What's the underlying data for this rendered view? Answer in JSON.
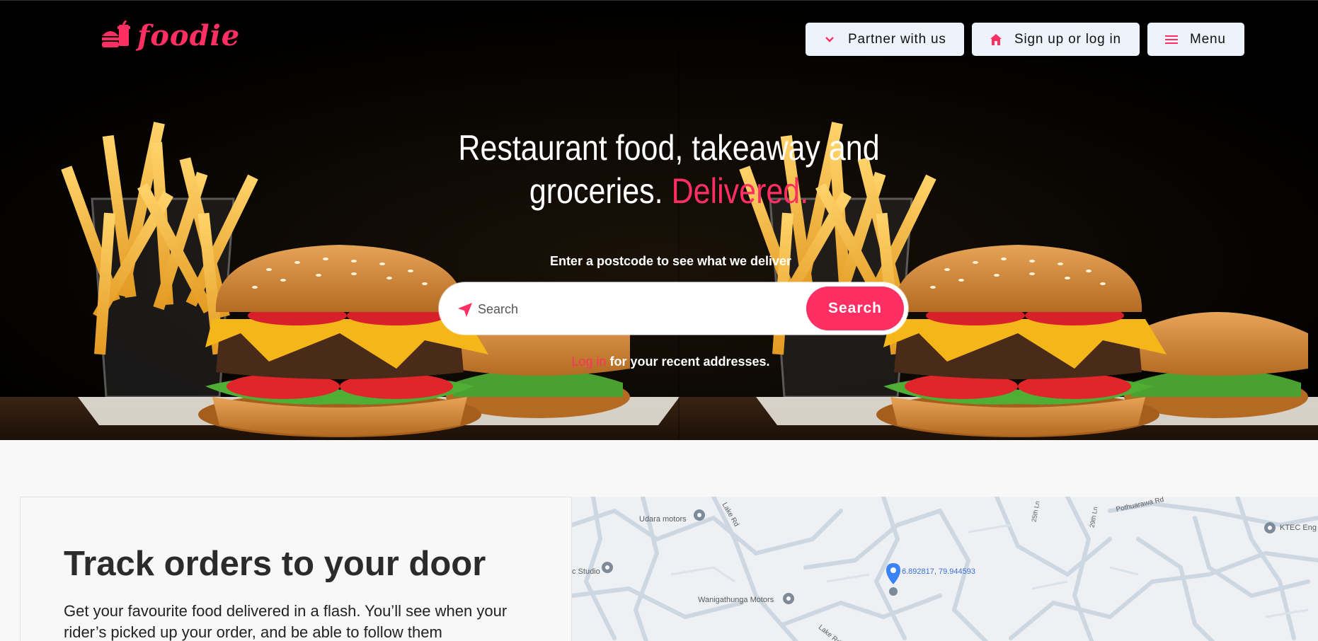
{
  "brand": {
    "name": "foodie",
    "accent_color": "#ff2e63"
  },
  "nav": {
    "partner_label": "Partner with us",
    "signup_label": "Sign up or log in",
    "menu_label": "Menu"
  },
  "hero": {
    "headline_part1": "Restaurant food, takeaway and",
    "headline_part2": "groceries.",
    "headline_accent": "Delivered.",
    "subline": "Enter a postcode to see what we deliver",
    "search_placeholder": "Search",
    "search_button": "Search",
    "login_link": "Log in",
    "login_suffix": " for your recent addresses."
  },
  "track": {
    "title": "Track orders to your door",
    "description": "Get your favourite food delivered in a flash. You’ll see when your rider’s picked up your order, and be able to follow them"
  },
  "map": {
    "places": {
      "udara": "Udara motors",
      "studio": "c Studio",
      "wanigathunga": "Wanigathunga Motors",
      "ktec": "KTEC Eng",
      "lake_rd_1": "Lake Rd",
      "lake_rd_2": "Lake Rd",
      "pothuarawa": "Pothuarawa Rd",
      "lane_25": "25th Ln",
      "lane_29": "29th Ln"
    },
    "coordinates": "6.892817, 79.944593"
  }
}
